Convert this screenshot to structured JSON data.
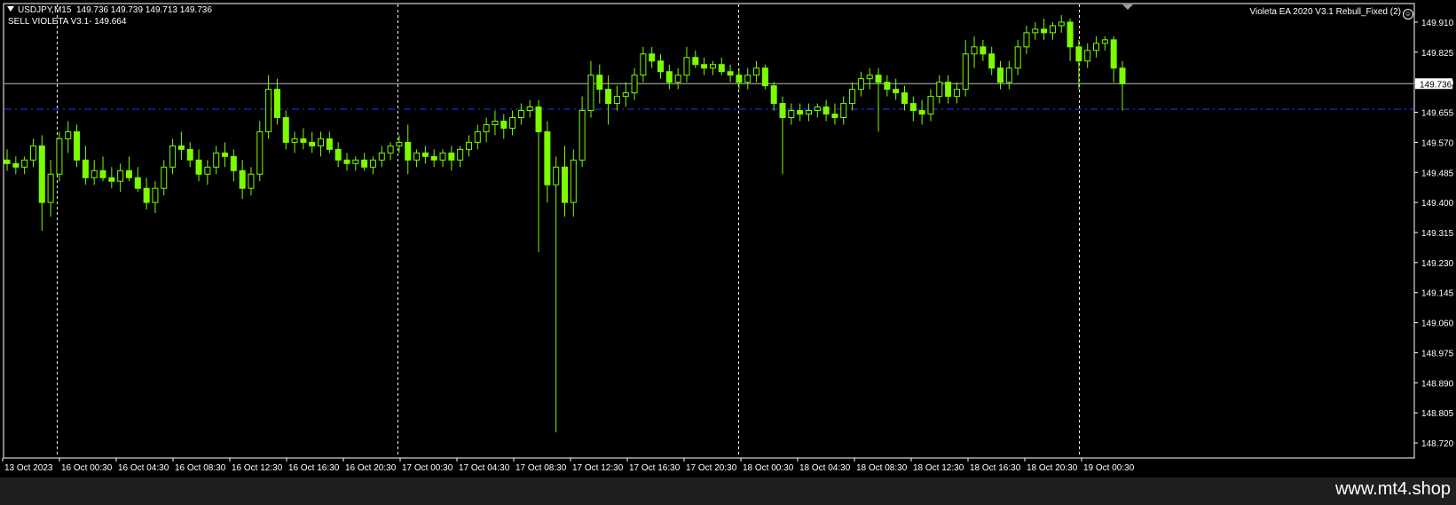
{
  "header": {
    "symbol": "USDJPY,M15",
    "ohlc": "149.736 149.739 149.713 149.736",
    "indicator": "SELL VIOLETA V3.1- 149.664",
    "ea_name": "Violeta EA 2020 V3.1 Rebull_Fixed (2)"
  },
  "footer": {
    "url": "www.mt4.shop"
  },
  "colors": {
    "background": "#000000",
    "candles": "#7CFC00",
    "grid": "#FFFFFF",
    "bid_line": "#BFBFBF",
    "signal_line": "#1E3CFF",
    "footer_bg": "#1F1F1F"
  },
  "chart_data": {
    "type": "candlestick",
    "title": "USDJPY,M15",
    "ylim": [
      148.68,
      149.96
    ],
    "yticks": [
      "149.910",
      "149.825",
      "149.740",
      "149.655",
      "149.570",
      "149.485",
      "149.400",
      "149.315",
      "149.230",
      "149.145",
      "149.060",
      "148.975",
      "148.890",
      "148.805",
      "148.720"
    ],
    "xticks": [
      "13 Oct 2023",
      "16 Oct 00:30",
      "16 Oct 04:30",
      "16 Oct 08:30",
      "16 Oct 12:30",
      "16 Oct 16:30",
      "16 Oct 20:30",
      "17 Oct 00:30",
      "17 Oct 04:30",
      "17 Oct 08:30",
      "17 Oct 12:30",
      "17 Oct 16:30",
      "17 Oct 20:30",
      "18 Oct 00:30",
      "18 Oct 04:30",
      "18 Oct 08:30",
      "18 Oct 12:30",
      "18 Oct 16:30",
      "18 Oct 20:30",
      "19 Oct 00:30"
    ],
    "day_separators": [
      "16 Oct 00:30",
      "17 Oct 00:30",
      "18 Oct 00:30",
      "19 Oct 00:30"
    ],
    "bid_price": "149.736",
    "sell_level": 149.664,
    "series": [
      {
        "points": [
          [
            0,
            149.52,
            149.55,
            149.49,
            149.51
          ],
          [
            1,
            149.51,
            149.53,
            149.48,
            149.5
          ],
          [
            2,
            149.5,
            149.53,
            149.48,
            149.52
          ],
          [
            3,
            149.52,
            149.58,
            149.5,
            149.56
          ],
          [
            4,
            149.56,
            149.59,
            149.32,
            149.4
          ],
          [
            5,
            149.4,
            149.52,
            149.36,
            149.48
          ],
          [
            6,
            149.48,
            149.6,
            149.46,
            149.58
          ],
          [
            7,
            149.58,
            149.63,
            149.54,
            149.6
          ],
          [
            8,
            149.6,
            149.62,
            149.5,
            149.52
          ],
          [
            9,
            149.52,
            149.56,
            149.45,
            149.47
          ],
          [
            10,
            149.47,
            149.52,
            149.45,
            149.49
          ],
          [
            11,
            149.49,
            149.53,
            149.46,
            149.47
          ],
          [
            12,
            149.47,
            149.5,
            149.44,
            149.46
          ],
          [
            13,
            149.46,
            149.51,
            149.43,
            149.49
          ],
          [
            14,
            149.49,
            149.53,
            149.46,
            149.47
          ],
          [
            15,
            149.47,
            149.5,
            149.43,
            149.44
          ],
          [
            16,
            149.44,
            149.47,
            149.38,
            149.4
          ],
          [
            17,
            149.4,
            149.46,
            149.37,
            149.44
          ],
          [
            18,
            149.44,
            149.52,
            149.42,
            149.5
          ],
          [
            19,
            149.5,
            149.58,
            149.48,
            149.56
          ],
          [
            20,
            149.56,
            149.6,
            149.52,
            149.55
          ],
          [
            21,
            149.55,
            149.57,
            149.5,
            149.52
          ],
          [
            22,
            149.52,
            149.55,
            149.46,
            149.48
          ],
          [
            23,
            149.48,
            149.52,
            149.45,
            149.5
          ],
          [
            24,
            149.5,
            149.56,
            149.48,
            149.54
          ],
          [
            25,
            149.54,
            149.57,
            149.5,
            149.53
          ],
          [
            26,
            149.53,
            149.55,
            149.46,
            149.49
          ],
          [
            27,
            149.49,
            149.52,
            149.41,
            149.44
          ],
          [
            28,
            149.44,
            149.5,
            149.42,
            149.48
          ],
          [
            29,
            149.48,
            149.63,
            149.46,
            149.6
          ],
          [
            30,
            149.6,
            149.76,
            149.58,
            149.72
          ],
          [
            31,
            149.72,
            149.75,
            149.62,
            149.64
          ],
          [
            32,
            149.64,
            149.66,
            149.55,
            149.57
          ],
          [
            33,
            149.57,
            149.6,
            149.54,
            149.58
          ],
          [
            34,
            149.58,
            149.61,
            149.55,
            149.57
          ],
          [
            35,
            149.57,
            149.6,
            149.54,
            149.56
          ],
          [
            36,
            149.56,
            149.6,
            149.53,
            149.58
          ],
          [
            37,
            149.58,
            149.6,
            149.54,
            149.55
          ],
          [
            38,
            149.55,
            149.57,
            149.5,
            149.52
          ],
          [
            39,
            149.52,
            149.54,
            149.49,
            149.51
          ],
          [
            40,
            149.51,
            149.53,
            149.49,
            149.52
          ],
          [
            41,
            149.52,
            149.54,
            149.49,
            149.5
          ],
          [
            42,
            149.5,
            149.53,
            149.48,
            149.52
          ],
          [
            43,
            149.52,
            149.56,
            149.5,
            149.54
          ],
          [
            44,
            149.54,
            149.57,
            149.52,
            149.56
          ],
          [
            45,
            149.56,
            149.59,
            149.54,
            149.57
          ],
          [
            46,
            149.57,
            149.62,
            149.48,
            149.52
          ],
          [
            47,
            149.52,
            149.55,
            149.5,
            149.54
          ],
          [
            48,
            149.54,
            149.56,
            149.51,
            149.53
          ],
          [
            49,
            149.53,
            149.55,
            149.5,
            149.52
          ],
          [
            50,
            149.52,
            149.55,
            149.5,
            149.54
          ],
          [
            51,
            149.54,
            149.56,
            149.49,
            149.52
          ],
          [
            52,
            149.52,
            149.56,
            149.5,
            149.55
          ],
          [
            53,
            149.55,
            149.59,
            149.53,
            149.57
          ],
          [
            54,
            149.57,
            149.62,
            149.55,
            149.6
          ],
          [
            55,
            149.6,
            149.64,
            149.57,
            149.62
          ],
          [
            56,
            149.62,
            149.66,
            149.59,
            149.63
          ],
          [
            57,
            149.63,
            149.65,
            149.58,
            149.61
          ],
          [
            58,
            149.61,
            149.66,
            149.59,
            149.64
          ],
          [
            59,
            149.64,
            149.68,
            149.62,
            149.66
          ],
          [
            60,
            149.66,
            149.69,
            149.64,
            149.67
          ],
          [
            61,
            149.67,
            149.69,
            149.26,
            149.6
          ],
          [
            62,
            149.6,
            149.63,
            149.4,
            149.45
          ],
          [
            63,
            149.45,
            149.53,
            148.75,
            149.5
          ],
          [
            64,
            149.5,
            149.56,
            149.36,
            149.4
          ],
          [
            65,
            149.4,
            149.55,
            149.36,
            149.52
          ],
          [
            66,
            149.52,
            149.7,
            149.5,
            149.66
          ],
          [
            67,
            149.66,
            149.8,
            149.64,
            149.76
          ],
          [
            68,
            149.76,
            149.79,
            149.68,
            149.72
          ],
          [
            69,
            149.72,
            149.76,
            149.62,
            149.68
          ],
          [
            70,
            149.68,
            149.73,
            149.66,
            149.7
          ],
          [
            71,
            149.7,
            149.74,
            149.67,
            149.71
          ],
          [
            72,
            149.71,
            149.78,
            149.69,
            149.76
          ],
          [
            73,
            149.76,
            149.84,
            149.74,
            149.82
          ],
          [
            74,
            149.82,
            149.84,
            149.78,
            149.8
          ],
          [
            75,
            149.8,
            149.82,
            149.75,
            149.77
          ],
          [
            76,
            149.77,
            149.79,
            149.72,
            149.74
          ],
          [
            77,
            149.74,
            149.78,
            149.72,
            149.76
          ],
          [
            78,
            149.76,
            149.84,
            149.74,
            149.81
          ],
          [
            79,
            149.81,
            149.83,
            149.78,
            149.79
          ],
          [
            80,
            149.79,
            149.81,
            149.76,
            149.78
          ],
          [
            81,
            149.78,
            149.8,
            149.76,
            149.79
          ],
          [
            82,
            149.79,
            149.81,
            149.76,
            149.77
          ],
          [
            83,
            149.77,
            149.79,
            149.74,
            149.76
          ],
          [
            84,
            149.76,
            149.78,
            149.72,
            149.74
          ],
          [
            85,
            149.74,
            149.78,
            149.72,
            149.76
          ],
          [
            86,
            149.76,
            149.8,
            149.74,
            149.78
          ],
          [
            87,
            149.78,
            149.79,
            149.72,
            149.73
          ],
          [
            88,
            149.73,
            149.74,
            149.66,
            149.68
          ],
          [
            89,
            149.68,
            149.7,
            149.48,
            149.64
          ],
          [
            90,
            149.64,
            149.68,
            149.62,
            149.66
          ],
          [
            91,
            149.66,
            149.68,
            149.63,
            149.65
          ],
          [
            92,
            149.65,
            149.68,
            149.63,
            149.66
          ],
          [
            93,
            149.66,
            149.68,
            149.64,
            149.67
          ],
          [
            94,
            149.67,
            149.69,
            149.63,
            149.65
          ],
          [
            95,
            149.65,
            149.68,
            149.62,
            149.64
          ],
          [
            96,
            149.64,
            149.7,
            149.62,
            149.68
          ],
          [
            97,
            149.68,
            149.74,
            149.66,
            149.72
          ],
          [
            98,
            149.72,
            149.77,
            149.7,
            149.75
          ],
          [
            99,
            149.75,
            149.78,
            149.72,
            149.76
          ],
          [
            100,
            149.76,
            149.78,
            149.6,
            149.74
          ],
          [
            101,
            149.74,
            149.76,
            149.7,
            149.72
          ],
          [
            102,
            149.72,
            149.75,
            149.69,
            149.71
          ],
          [
            103,
            149.71,
            149.73,
            149.66,
            149.68
          ],
          [
            104,
            149.68,
            149.7,
            149.63,
            149.66
          ],
          [
            105,
            149.66,
            149.69,
            149.62,
            149.65
          ],
          [
            106,
            149.65,
            149.72,
            149.63,
            149.7
          ],
          [
            107,
            149.7,
            149.76,
            149.68,
            149.74
          ],
          [
            108,
            149.74,
            149.76,
            149.68,
            149.7
          ],
          [
            109,
            149.7,
            149.74,
            149.68,
            149.72
          ],
          [
            110,
            149.72,
            149.86,
            149.7,
            149.82
          ],
          [
            111,
            149.82,
            149.87,
            149.78,
            149.84
          ],
          [
            112,
            149.84,
            149.86,
            149.8,
            149.82
          ],
          [
            113,
            149.82,
            149.84,
            149.76,
            149.78
          ],
          [
            114,
            149.78,
            149.8,
            149.72,
            149.74
          ],
          [
            115,
            149.74,
            149.8,
            149.72,
            149.78
          ],
          [
            116,
            149.78,
            149.86,
            149.76,
            149.84
          ],
          [
            117,
            149.84,
            149.9,
            149.82,
            149.88
          ],
          [
            118,
            149.88,
            149.91,
            149.86,
            149.89
          ],
          [
            119,
            149.89,
            149.92,
            149.86,
            149.88
          ],
          [
            120,
            149.88,
            149.91,
            149.86,
            149.9
          ],
          [
            121,
            149.9,
            149.93,
            149.88,
            149.91
          ],
          [
            122,
            149.91,
            149.92,
            149.8,
            149.84
          ],
          [
            123,
            149.84,
            149.86,
            149.72,
            149.8
          ],
          [
            124,
            149.8,
            149.85,
            149.78,
            149.83
          ],
          [
            125,
            149.83,
            149.87,
            149.81,
            149.85
          ],
          [
            126,
            149.85,
            149.87,
            149.83,
            149.86
          ],
          [
            127,
            149.86,
            149.87,
            149.74,
            149.78
          ],
          [
            128,
            149.78,
            149.8,
            149.66,
            149.736
          ]
        ]
      }
    ]
  }
}
